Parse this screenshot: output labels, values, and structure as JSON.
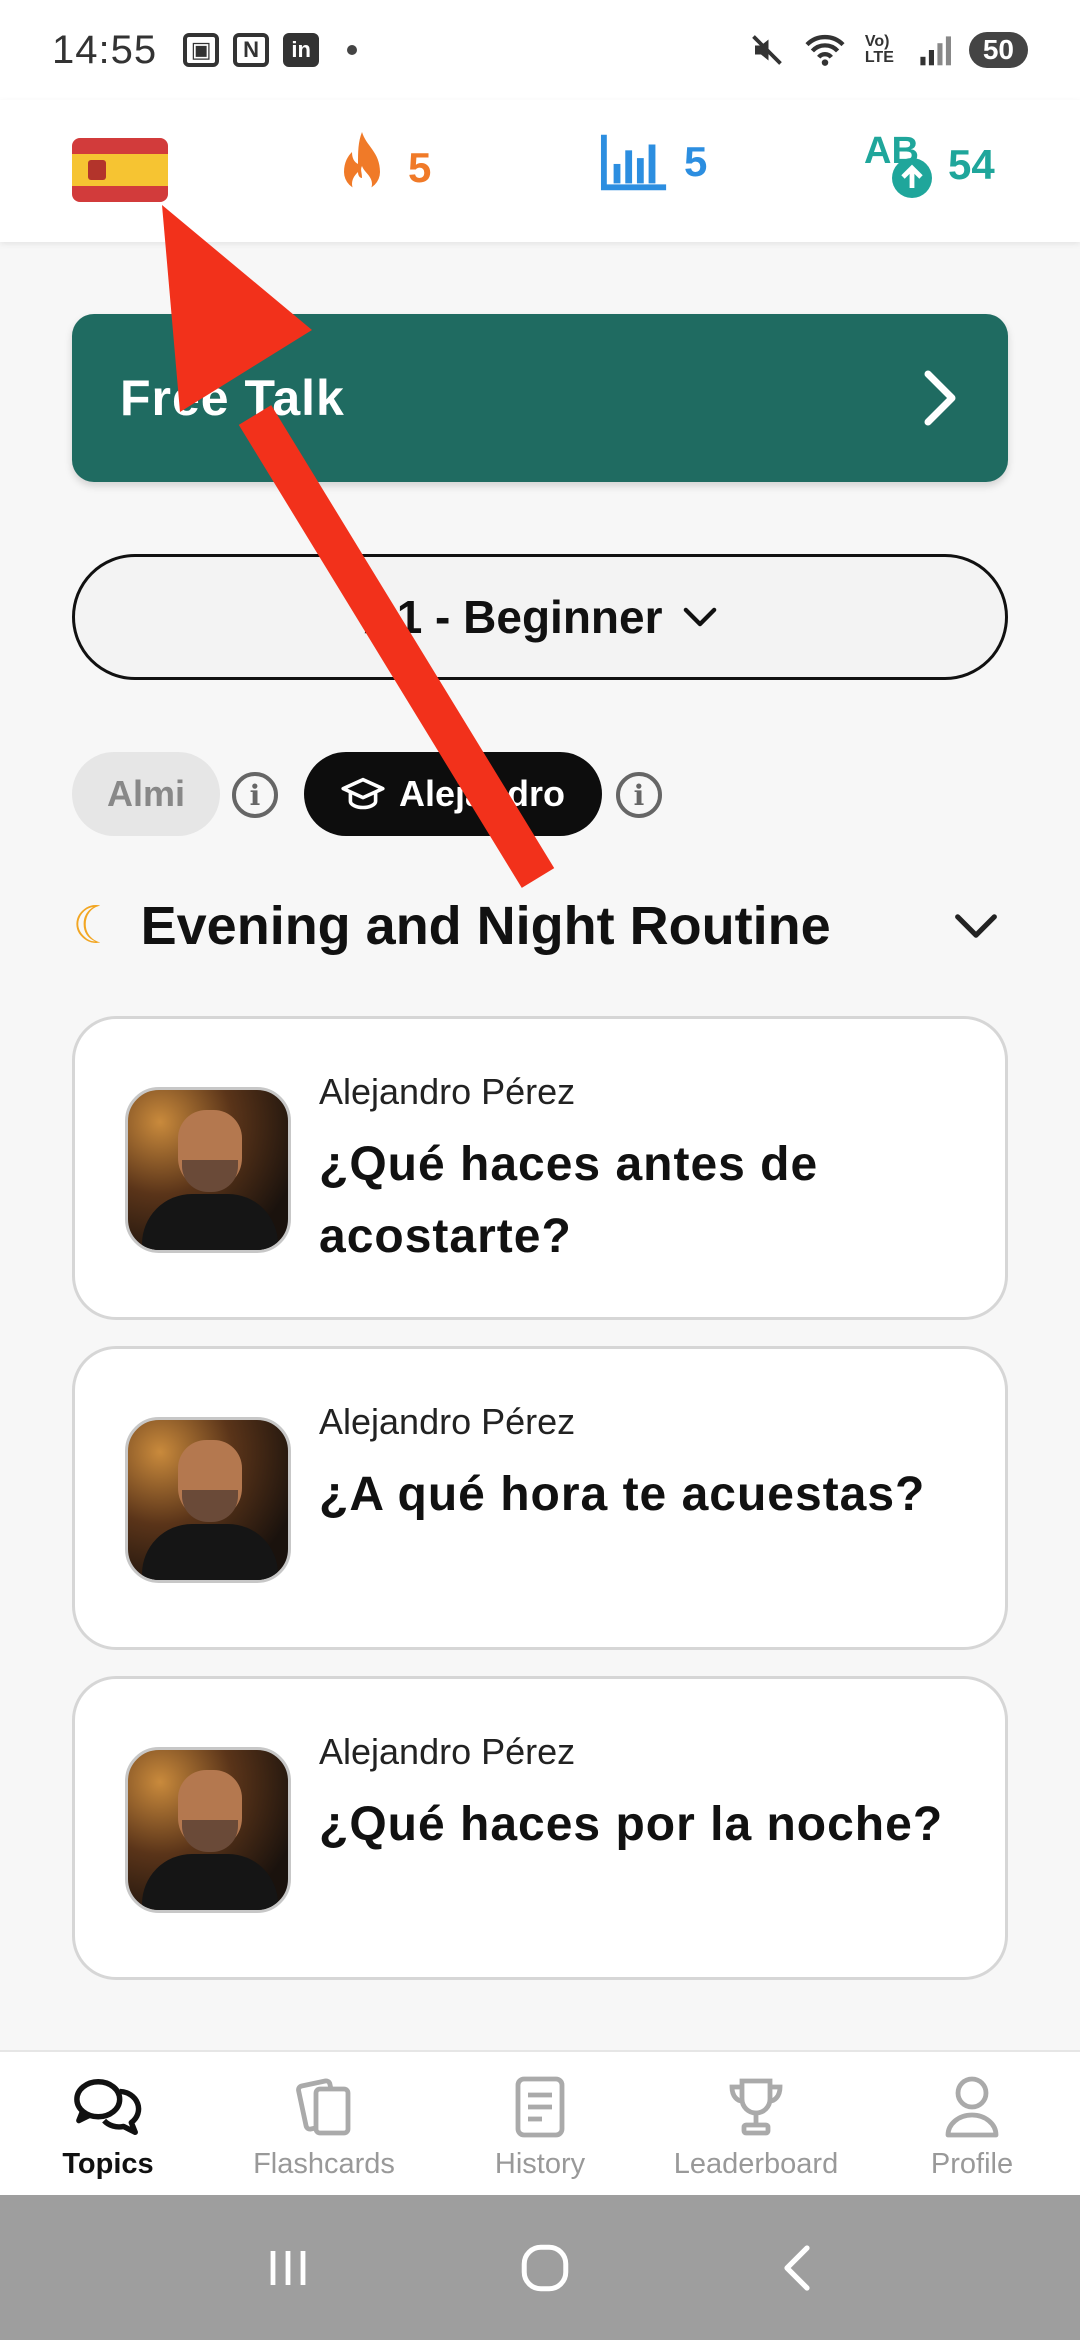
{
  "status_bar": {
    "time": "14:55",
    "battery": "50",
    "signal_label": "Vo) LTE",
    "icon_n": "N",
    "icon_in": "in"
  },
  "header": {
    "language_flag": "spain-flag",
    "streak": "5",
    "level_count": "5",
    "words_count": "54",
    "words_icon_text": "AB",
    "colors": {
      "streak": "#f07a28",
      "level": "#2c8ee0",
      "words": "#1fa69b"
    }
  },
  "free_talk": {
    "label": "Free Talk",
    "color": "#1f6b61"
  },
  "level_select": {
    "value": "A1 - Beginner"
  },
  "tutors": {
    "almi": "Almi",
    "alejandro": "Alejandro"
  },
  "section": {
    "title": "Evening and Night Routine",
    "icon": "crescent-moon-icon"
  },
  "cards": [
    {
      "name": "Alejandro Pérez",
      "question": " ¿Qué haces antes de acostarte?"
    },
    {
      "name": "Alejandro Pérez",
      "question": " ¿A qué hora te acuestas?"
    },
    {
      "name": "Alejandro Pérez",
      "question": "¿Qué haces por la noche?"
    }
  ],
  "tabs": [
    {
      "label": "Topics",
      "icon": "chat-bubbles-icon",
      "active": true
    },
    {
      "label": "Flashcards",
      "icon": "flashcards-icon",
      "active": false
    },
    {
      "label": "History",
      "icon": "document-icon",
      "active": false
    },
    {
      "label": "Leaderboard",
      "icon": "trophy-icon",
      "active": false
    },
    {
      "label": "Profile",
      "icon": "person-icon",
      "active": false
    }
  ]
}
